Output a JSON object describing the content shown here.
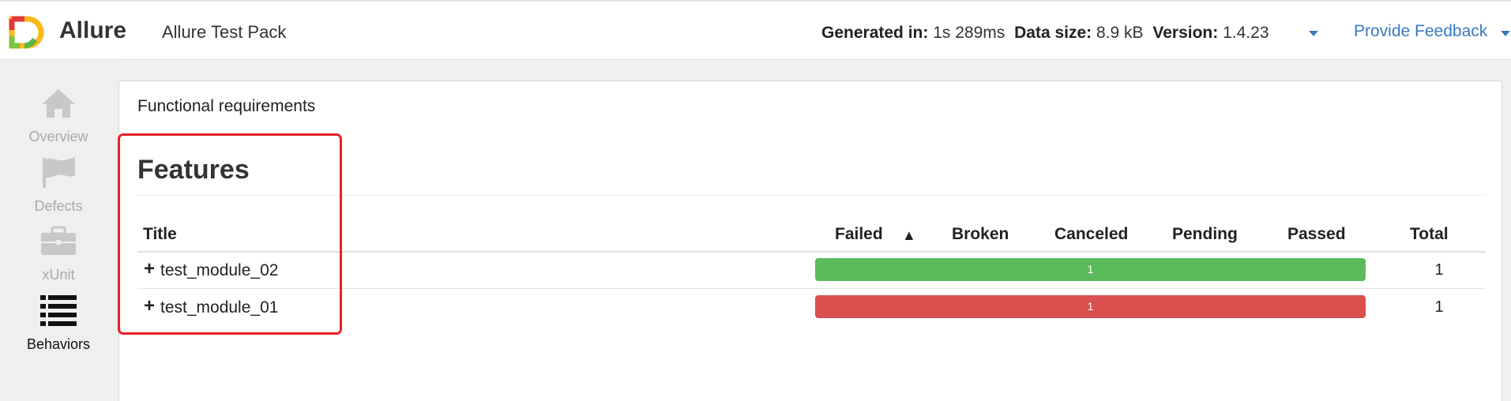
{
  "header": {
    "brand": "Allure",
    "report_name": "Allure Test Pack",
    "generated_label": "Generated in:",
    "generated_value": "1s 289ms",
    "data_size_label": "Data size:",
    "data_size_value": "8.9 kB",
    "version_label": "Version:",
    "version_value": "1.4.23",
    "feedback": "Provide Feedback"
  },
  "sidebar": {
    "items": [
      {
        "label": "Overview",
        "icon": "home-icon",
        "active": false
      },
      {
        "label": "Defects",
        "icon": "flag-icon",
        "active": false
      },
      {
        "label": "xUnit",
        "icon": "briefcase-icon",
        "active": false
      },
      {
        "label": "Behaviors",
        "icon": "list-icon",
        "active": true
      }
    ]
  },
  "main": {
    "breadcrumb": "Functional requirements",
    "title": "Features",
    "columns": {
      "title": "Title",
      "failed": "Failed",
      "sort_indicator": "▲",
      "broken": "Broken",
      "canceled": "Canceled",
      "pending": "Pending",
      "passed": "Passed",
      "total": "Total"
    },
    "rows": [
      {
        "name": "test_module_02",
        "bar_value": "1",
        "status": "passed",
        "total": "1"
      },
      {
        "name": "test_module_01",
        "bar_value": "1",
        "status": "failed",
        "total": "1"
      }
    ]
  },
  "colors": {
    "accent": "#3a7ac2",
    "passed": "#5bbb5b",
    "failed": "#d9504f",
    "highlight": "#e8202a"
  }
}
